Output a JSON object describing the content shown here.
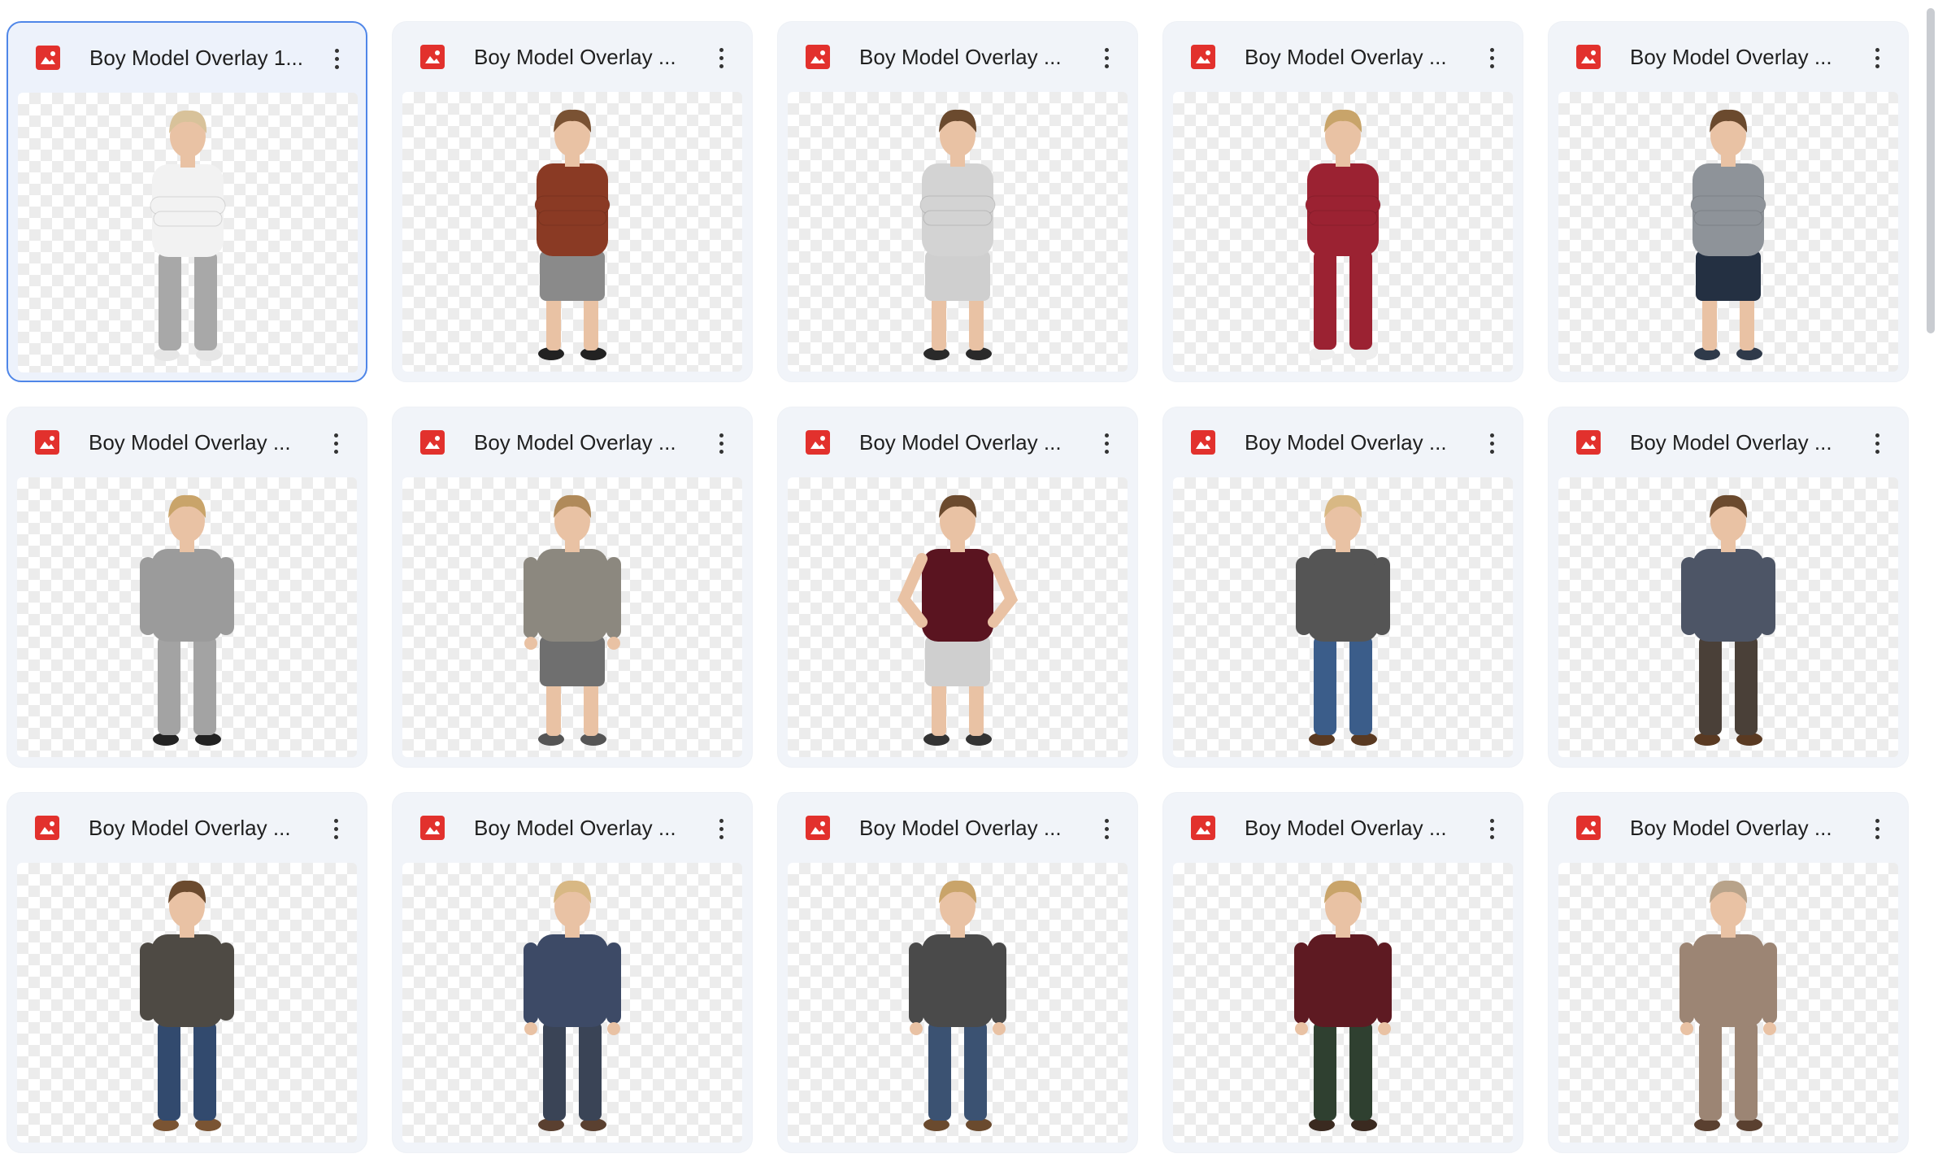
{
  "files": [
    {
      "name": "Boy Model Overlay 1...",
      "selected": true,
      "subject": {
        "top": "#f2f2f2",
        "bottom": "#a8a8a8",
        "hair": "#d8c29a",
        "shoes": "#e6e6e6",
        "pose": "arms-crossed",
        "long_pants": true
      }
    },
    {
      "name": "Boy Model Overlay ...",
      "selected": false,
      "subject": {
        "top": "#8a3a24",
        "bottom": "#8a8a8a",
        "hair": "#7a5233",
        "shoes": "#222222",
        "pose": "arms-crossed",
        "long_pants": false
      }
    },
    {
      "name": "Boy Model Overlay ...",
      "selected": false,
      "subject": {
        "top": "#d3d3d3",
        "bottom": "#cfcfcf",
        "hair": "#6b4a2e",
        "shoes": "#2a2a2a",
        "pose": "arms-crossed",
        "long_pants": false
      }
    },
    {
      "name": "Boy Model Overlay ...",
      "selected": false,
      "subject": {
        "top": "#9b2232",
        "bottom": "#9b2232",
        "hair": "#c8a46a",
        "shoes": "#eeeeee",
        "pose": "arms-crossed",
        "long_pants": true
      }
    },
    {
      "name": "Boy Model Overlay ...",
      "selected": false,
      "subject": {
        "top": "#8e9399",
        "bottom": "#243042",
        "hair": "#6b4a2e",
        "shoes": "#2f3a4a",
        "pose": "arms-crossed",
        "long_pants": false
      }
    },
    {
      "name": "Boy Model Overlay ...",
      "selected": false,
      "subject": {
        "top": "#9b9b9b",
        "bottom": "#a3a3a3",
        "hair": "#c9a46a",
        "shoes": "#222222",
        "pose": "hands-pockets",
        "long_pants": true
      }
    },
    {
      "name": "Boy Model Overlay ...",
      "selected": false,
      "subject": {
        "top": "#8c887f",
        "bottom": "#6f6f6f",
        "hair": "#b08a5a",
        "shoes": "#555555",
        "pose": "arms-down",
        "long_pants": false
      }
    },
    {
      "name": "Boy Model Overlay ...",
      "selected": false,
      "subject": {
        "top": "#5a1420",
        "bottom": "#cfcfcf",
        "hair": "#6b4a2e",
        "shoes": "#333333",
        "pose": "hands-hips",
        "long_pants": false
      }
    },
    {
      "name": "Boy Model Overlay ...",
      "selected": false,
      "subject": {
        "top": "#555555",
        "bottom": "#3b5d8a",
        "hair": "#d8b884",
        "shoes": "#5a3a22",
        "pose": "hands-pockets",
        "long_pants": true
      }
    },
    {
      "name": "Boy Model Overlay ...",
      "selected": false,
      "subject": {
        "top": "#4d5566",
        "bottom": "#4a4038",
        "hair": "#6b4a2e",
        "shoes": "#5a3a22",
        "pose": "hands-pockets",
        "long_pants": true
      }
    },
    {
      "name": "Boy Model Overlay ...",
      "selected": false,
      "subject": {
        "top": "#4e4a44",
        "bottom": "#324a6e",
        "hair": "#6b4a2e",
        "shoes": "#7a5433",
        "pose": "hands-pockets",
        "long_pants": true
      }
    },
    {
      "name": "Boy Model Overlay ...",
      "selected": false,
      "subject": {
        "top": "#3d4a66",
        "bottom": "#3a4456",
        "hair": "#d8b884",
        "shoes": "#5a4030",
        "pose": "arms-down",
        "long_pants": true
      }
    },
    {
      "name": "Boy Model Overlay ...",
      "selected": false,
      "subject": {
        "top": "#4a4a4a",
        "bottom": "#3b5272",
        "hair": "#c9a46a",
        "shoes": "#6a4a2e",
        "pose": "arms-down",
        "long_pants": true
      }
    },
    {
      "name": "Boy Model Overlay ...",
      "selected": false,
      "subject": {
        "top": "#5e1a22",
        "bottom": "#2f4030",
        "hair": "#c9a46a",
        "shoes": "#3a2a20",
        "pose": "arms-down",
        "long_pants": true
      }
    },
    {
      "name": "Boy Model Overlay ...",
      "selected": false,
      "subject": {
        "top": "#9c8574",
        "bottom": "#9c8574",
        "hair": "#b8a38a",
        "shoes": "#5a4030",
        "pose": "arms-down",
        "long_pants": true
      }
    }
  ],
  "icons": {
    "file_type": "image-file-icon",
    "menu": "more-vert-icon"
  },
  "colors": {
    "accent_selected": "#4f86e8",
    "file_icon": "#e2312d",
    "card_bg": "#f1f4f9"
  }
}
